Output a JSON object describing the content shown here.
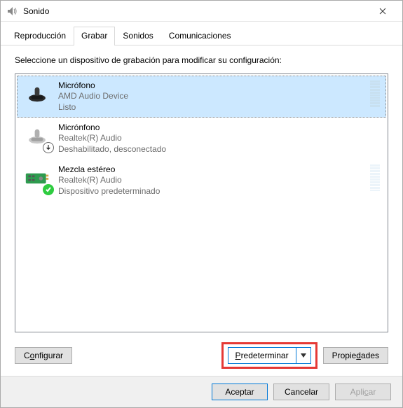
{
  "window": {
    "title": "Sonido"
  },
  "tabs": [
    {
      "label": "Reproducción"
    },
    {
      "label": "Grabar"
    },
    {
      "label": "Sonidos"
    },
    {
      "label": "Comunicaciones"
    }
  ],
  "instruction": "Seleccione un dispositivo de grabación para modificar su configuración:",
  "devices": [
    {
      "name": "Micrófono",
      "subtitle": "AMD Audio Device",
      "status": "Listo",
      "icon": "microphone-icon",
      "selected": true,
      "meter": true,
      "badge": null
    },
    {
      "name": "Micrónfono",
      "subtitle": "Realtek(R) Audio",
      "status": "Deshabilitado, desconectado",
      "icon": "microphone-icon",
      "selected": false,
      "meter": false,
      "badge": "down"
    },
    {
      "name": "Mezcla estéreo",
      "subtitle": "Realtek(R) Audio",
      "status": "Dispositivo predeterminado",
      "icon": "soundcard-icon",
      "selected": false,
      "meter": true,
      "badge": "check"
    }
  ],
  "buttons": {
    "configure": "Configurar",
    "set_default": "Predeterminar",
    "properties": "Propiedades",
    "ok": "Aceptar",
    "cancel": "Cancelar",
    "apply": "Aplicar"
  }
}
